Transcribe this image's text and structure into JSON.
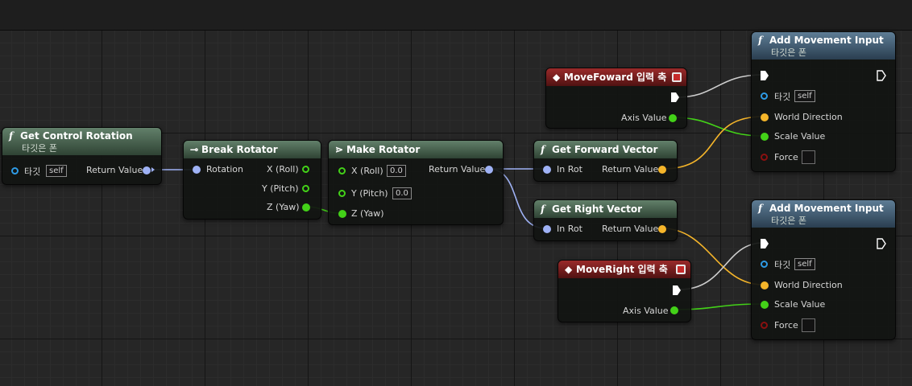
{
  "nodes": {
    "get_control_rotation": {
      "title": "Get Control Rotation",
      "subtitle": "타깃은 폰",
      "target_label": "타깃",
      "target_value": "self",
      "return_label": "Return Value"
    },
    "break_rotator": {
      "title": "Break Rotator",
      "input_label": "Rotation",
      "out_x": "X (Roll)",
      "out_y": "Y (Pitch)",
      "out_z": "Z (Yaw)"
    },
    "make_rotator": {
      "title": "Make Rotator",
      "in_x": "X (Roll)",
      "in_x_value": "0.0",
      "in_y": "Y (Pitch)",
      "in_y_value": "0.0",
      "in_z": "Z (Yaw)",
      "return_label": "Return Value"
    },
    "move_forward": {
      "title": "MoveFoward 입력 축",
      "axis_label": "Axis Value"
    },
    "move_right": {
      "title": "MoveRight 입력 축",
      "axis_label": "Axis Value"
    },
    "get_forward_vector": {
      "title": "Get Forward Vector",
      "in_label": "In Rot",
      "return_label": "Return Value"
    },
    "get_right_vector": {
      "title": "Get Right Vector",
      "in_label": "In Rot",
      "return_label": "Return Value"
    },
    "add_movement_1": {
      "title": "Add Movement Input",
      "subtitle": "타깃은 폰",
      "target_label": "타깃",
      "target_value": "self",
      "world_direction": "World Direction",
      "scale_value": "Scale Value",
      "force": "Force"
    },
    "add_movement_2": {
      "title": "Add Movement Input",
      "subtitle": "타깃은 폰",
      "target_label": "타깃",
      "target_value": "self",
      "world_direction": "World Direction",
      "scale_value": "Scale Value",
      "force": "Force"
    }
  },
  "icons": {
    "function": "function-icon",
    "event": "event-diamond-icon",
    "break": "break-struct-icon",
    "make": "make-struct-icon",
    "exec": "exec-pin-icon"
  },
  "colors": {
    "rotator_pin": "#9fb2f5",
    "vector_pin": "#f5b52a",
    "float_pin": "#43d118",
    "object_pin": "#2e9be6",
    "bool_pin": "#8a1010",
    "exec_pin": "#ffffff",
    "function_header": "#4e6d57",
    "target_function_header": "#4a6a84",
    "event_header": "#8a2020"
  }
}
